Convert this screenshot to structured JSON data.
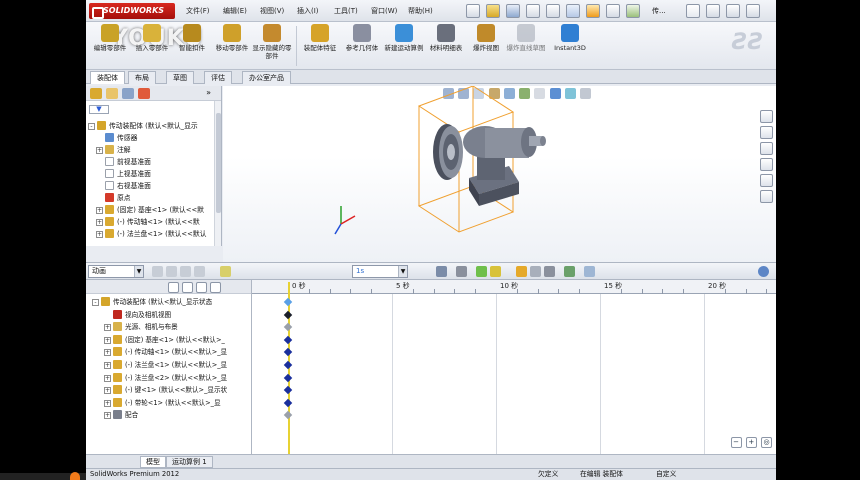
{
  "app": {
    "name": "SOLIDWORKS",
    "watermark": "YOUKU",
    "doc_title": "传..."
  },
  "menu": [
    "文件(F)",
    "编辑(E)",
    "视图(V)",
    "插入(I)",
    "工具(T)",
    "窗口(W)",
    "帮助(H)"
  ],
  "ribbon": {
    "buttons": [
      {
        "label": "编辑零部件",
        "icon": "edit-component-icon",
        "color": "#c9a227"
      },
      {
        "label": "插入零部件",
        "icon": "insert-component-icon",
        "color": "#d9b23a"
      },
      {
        "label": "智能扣件",
        "icon": "smart-fastener-icon",
        "color": "#b78a1e"
      },
      {
        "label": "移动零部件",
        "icon": "move-component-icon",
        "color": "#cfa02a"
      },
      {
        "label": "显示隐藏的零部件",
        "icon": "show-hidden-icon",
        "color": "#c48a2e"
      },
      {
        "label": "装配体特征",
        "icon": "assembly-feature-icon",
        "color": "#d6a328"
      },
      {
        "label": "参考几何体",
        "icon": "reference-geometry-icon",
        "color": "#8a8fa0"
      },
      {
        "label": "新建运动算例",
        "icon": "new-motion-study-icon",
        "color": "#3b8fd8"
      },
      {
        "label": "材料明细表",
        "icon": "bom-icon",
        "color": "#6a6f7c"
      },
      {
        "label": "爆炸视图",
        "icon": "exploded-view-icon",
        "color": "#c08a2a"
      },
      {
        "label": "爆炸直线草图",
        "icon": "explode-line-sketch-icon",
        "color": "#a7adb8"
      },
      {
        "label": "Instant3D",
        "icon": "instant3d-icon",
        "color": "#2f7fd3"
      }
    ]
  },
  "cm_tabs": [
    "装配体",
    "布局",
    "草图",
    "评估",
    "办公室产品"
  ],
  "feature_tree": {
    "filter": "▼",
    "rows": [
      {
        "text": "传动装配体 (默认<默认_显示",
        "icon": "assembly-icon",
        "color": "#d4a52a",
        "expand": "-"
      },
      {
        "text": "传感器",
        "icon": "sensor-icon",
        "color": "#5b8ccf",
        "expand": ""
      },
      {
        "text": "注解",
        "icon": "annotation-icon",
        "color": "#d8b24a",
        "expand": "+"
      },
      {
        "text": "前视基准面",
        "icon": "plane-icon",
        "color": "#ffffff",
        "expand": ""
      },
      {
        "text": "上视基准面",
        "icon": "plane-icon",
        "color": "#ffffff",
        "expand": ""
      },
      {
        "text": "右视基准面",
        "icon": "plane-icon",
        "color": "#ffffff",
        "expand": ""
      },
      {
        "text": "原点",
        "icon": "origin-icon",
        "color": "#d43a2a",
        "expand": ""
      },
      {
        "text": "(固定) 基座<1> (默认<<默",
        "icon": "part-icon",
        "color": "#d9a930",
        "expand": "+"
      },
      {
        "text": "(-) 传动轴<1> (默认<<默",
        "icon": "part-icon",
        "color": "#d9a930",
        "expand": "+"
      },
      {
        "text": "(-) 法兰盘<1> (默认<<默认",
        "icon": "part-icon",
        "color": "#d9a930",
        "expand": "+"
      }
    ]
  },
  "motion": {
    "study_type": "动画",
    "time_field": "1s",
    "ruler": [
      "0 秒",
      "5 秒",
      "10 秒",
      "15 秒",
      "20 秒"
    ],
    "tree": [
      {
        "text": "传动装配体 (默认<默认_显示状态",
        "icon": "assembly-icon",
        "color": "#d4a52a",
        "expand": "-"
      },
      {
        "text": "视向及相机视图",
        "icon": "camera-view-icon",
        "color": "#c0281f",
        "expand": ""
      },
      {
        "text": "光源、相机与布景",
        "icon": "lights-icon",
        "color": "#d8b24a",
        "expand": "+"
      },
      {
        "text": "(固定) 基座<1> (默认<<默认>_",
        "icon": "part-icon",
        "color": "#d9a930",
        "expand": "+"
      },
      {
        "text": "(-) 传动轴<1> (默认<<默认>_显",
        "icon": "part-icon",
        "color": "#d9a930",
        "expand": "+"
      },
      {
        "text": "(-) 法兰盘<1> (默认<<默认>_显",
        "icon": "part-icon",
        "color": "#d9a930",
        "expand": "+"
      },
      {
        "text": "(-) 法兰盘<2> (默认<<默认>_显",
        "icon": "part-icon",
        "color": "#d9a930",
        "expand": "+"
      },
      {
        "text": "(-) 键<1> (默认<<默认>_显示状",
        "icon": "part-icon",
        "color": "#d9a930",
        "expand": "+"
      },
      {
        "text": "(-) 带轮<1> (默认<<默认>_显",
        "icon": "part-icon",
        "color": "#d9a930",
        "expand": "+"
      },
      {
        "text": "配合",
        "icon": "mates-icon",
        "color": "#7a7f8c",
        "expand": "+"
      }
    ],
    "key_colors": [
      "#5aa0e6",
      "#1b1f2a",
      "#9aa0aa",
      "#1a2f9c",
      "#1a2f9c",
      "#1a2f9c",
      "#1a2f9c",
      "#1a2f9c",
      "#1a2f9c",
      "#9aa0aa"
    ]
  },
  "bottom_tabs": [
    "模型",
    "运动算例 1"
  ],
  "status": {
    "product": "SolidWorks Premium 2012",
    "state1": "欠定义",
    "state2": "在编辑 装配体",
    "custom": "自定义"
  },
  "colors": {
    "accent": "#2f6fd0",
    "keyframe": "#1a2f9c",
    "timebar": "#e7d233",
    "model_box": "#f0a030"
  }
}
